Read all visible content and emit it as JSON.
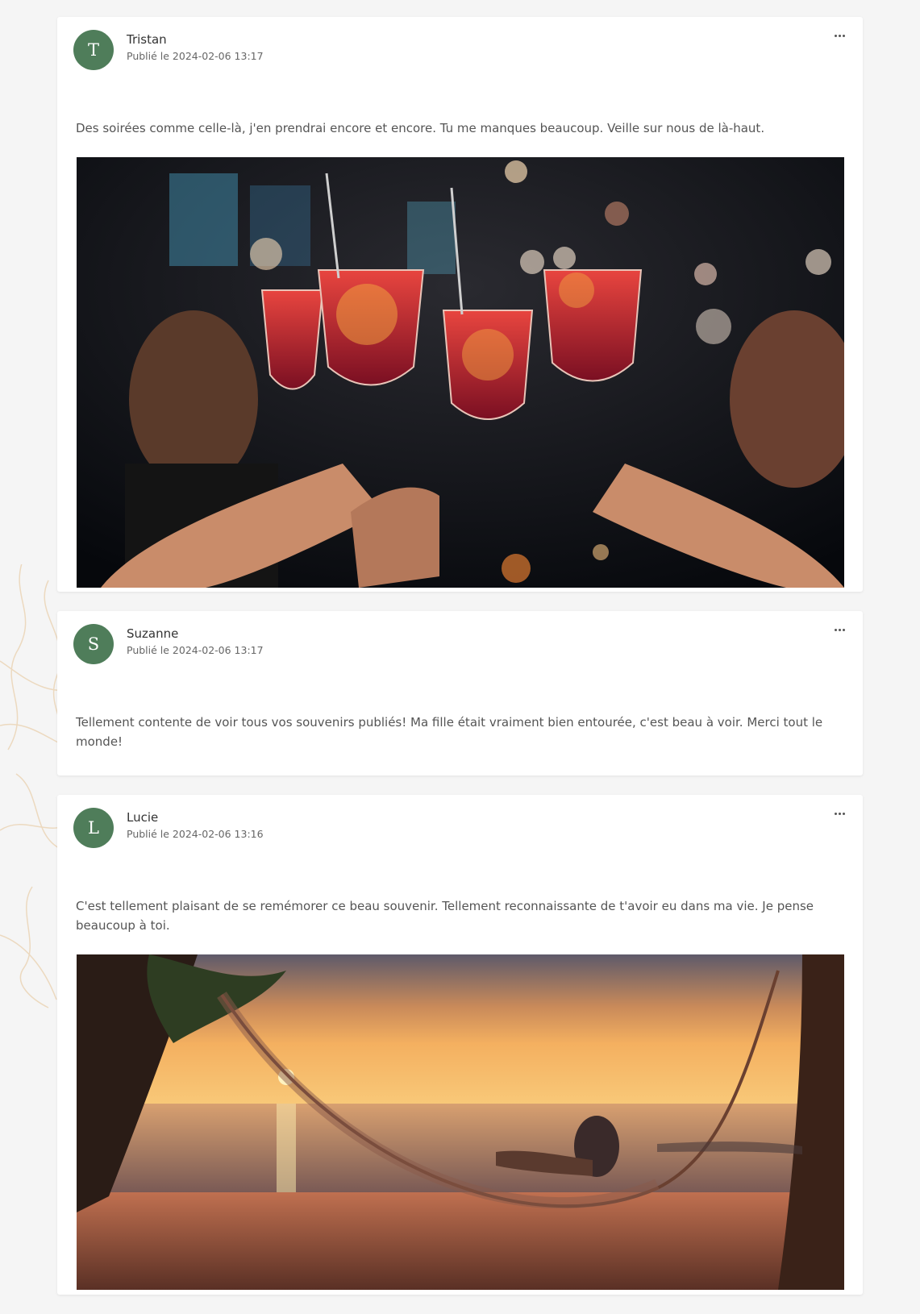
{
  "posts": [
    {
      "avatar_letter": "T",
      "author": "Tristan",
      "meta": "Publié le 2024-02-06 13:17",
      "text": "Des soirées comme celle-là, j'en prendrai encore et encore. Tu me manques beaucoup. Veille sur nous de là-haut.",
      "image": "cocktails-toast-photo"
    },
    {
      "avatar_letter": "S",
      "author": "Suzanne",
      "meta": "Publié le 2024-02-06 13:17",
      "text": "Tellement contente de voir tous vos souvenirs publiés! Ma fille était vraiment bien entourée, c'est beau à voir. Merci tout le monde!"
    },
    {
      "avatar_letter": "L",
      "author": "Lucie",
      "meta": "Publié le 2024-02-06 13:16",
      "text": "C'est tellement plaisant de se remémorer ce beau souvenir. Tellement reconnaissante de t'avoir eu dans ma vie. Je pense beaucoup à toi.",
      "image": "hammock-sunset-photo"
    }
  ],
  "icons": {
    "more": "more-horizontal-icon"
  },
  "colors": {
    "avatar_bg": "#4f7d5a",
    "page_bg": "#f5f5f5"
  }
}
